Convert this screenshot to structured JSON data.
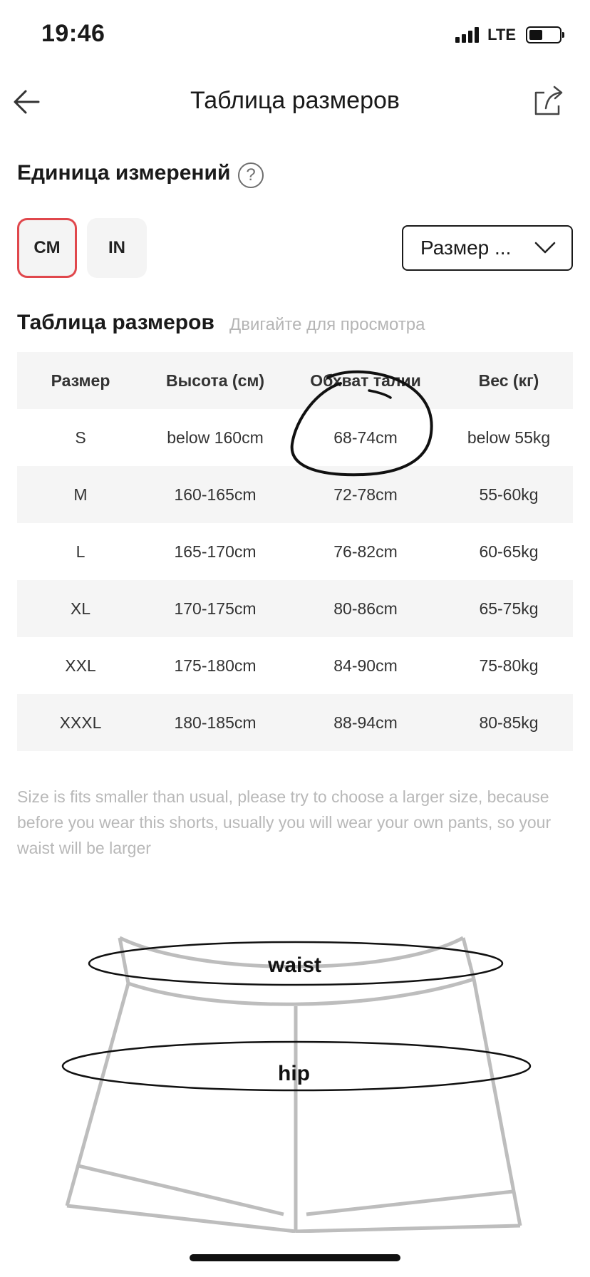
{
  "status_bar": {
    "time": "19:46",
    "network": "LTE"
  },
  "header": {
    "title": "Таблица размеров"
  },
  "units": {
    "heading": "Единица измерений",
    "options": [
      "CM",
      "IN"
    ],
    "selected": "CM"
  },
  "size_select": {
    "label": "Размер ..."
  },
  "size_table": {
    "heading": "Таблица размеров",
    "hint": "Двигайте для просмотра",
    "columns": [
      "Размер",
      "Высота (см)",
      "Обхват талии",
      "Вес (кг)"
    ],
    "rows": [
      [
        "S",
        "below 160cm",
        "68-74cm",
        "below 55kg"
      ],
      [
        "M",
        "160-165cm",
        "72-78cm",
        "55-60kg"
      ],
      [
        "L",
        "165-170cm",
        "76-82cm",
        "60-65kg"
      ],
      [
        "XL",
        "170-175cm",
        "80-86cm",
        "65-75kg"
      ],
      [
        "XXL",
        "175-180cm",
        "84-90cm",
        "75-80kg"
      ],
      [
        "XXXL",
        "180-185cm",
        "88-94cm",
        "80-85kg"
      ]
    ]
  },
  "note": "Size is fits smaller than usual, please try to choose a larger size, because before you wear this shorts, usually you will wear your own pants, so your waist will be larger",
  "diagram": {
    "waist_label": "waist",
    "hip_label": "hip"
  }
}
